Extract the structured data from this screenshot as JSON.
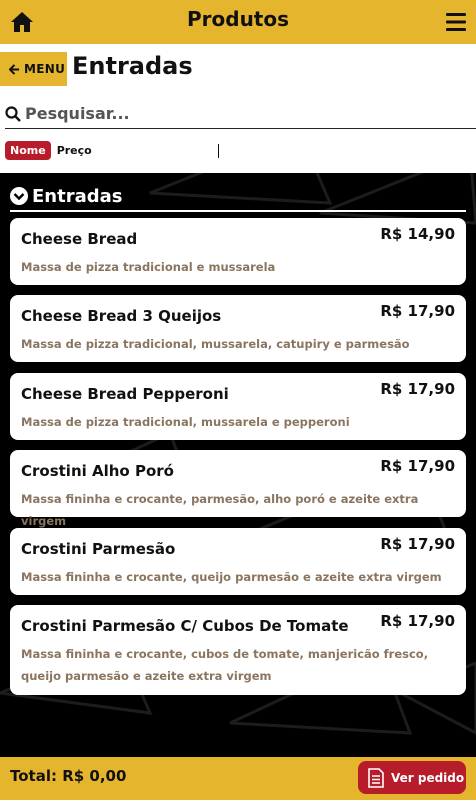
{
  "header": {
    "title": "Produtos",
    "home_icon": "home-icon",
    "menu_icon": "hamburger-menu-icon"
  },
  "nav": {
    "back_label": "MENU",
    "back_icon": "arrow-left-icon"
  },
  "page": {
    "title": "Entradas"
  },
  "search": {
    "placeholder": "Pesquisar...",
    "icon": "search-icon"
  },
  "sort": {
    "active": "Nome",
    "other": "Preço"
  },
  "section": {
    "title": "Entradas",
    "icon": "chevron-down-circle-icon"
  },
  "products": [
    {
      "name": "Cheese Bread",
      "price": "R$ 14,90",
      "desc": "Massa de pizza tradicional e mussarela"
    },
    {
      "name": "Cheese Bread 3 Queijos",
      "price": "R$ 17,90",
      "desc": "Massa de pizza tradicional, mussarela, catupiry e parmesão"
    },
    {
      "name": "Cheese Bread Pepperoni",
      "price": "R$ 17,90",
      "desc": "Massa de pizza tradicional, mussarela e pepperoni"
    },
    {
      "name": "Crostini Alho Poró",
      "price": "R$ 17,90",
      "desc": "Massa fininha e crocante, parmesão, alho poró e azeite extra virgem"
    },
    {
      "name": "Crostini Parmesão",
      "price": "R$ 17,90",
      "desc": "Massa fininha e crocante, queijo parmesão e azeite extra virgem"
    },
    {
      "name": "Crostini Parmesão C/ Cubos De Tomate",
      "price": "R$ 17,90",
      "desc": "Massa fininha e crocante, cubos de tomate, manjericão fresco, queijo parmesão e azeite extra virgem"
    }
  ],
  "footer": {
    "total": "Total: R$ 0,00",
    "order_label": "Ver pedido",
    "order_icon": "receipt-icon"
  },
  "colors": {
    "accent": "#e6b52e",
    "button_red": "#b71c2a",
    "description": "#8a7560",
    "background": "#000000"
  }
}
